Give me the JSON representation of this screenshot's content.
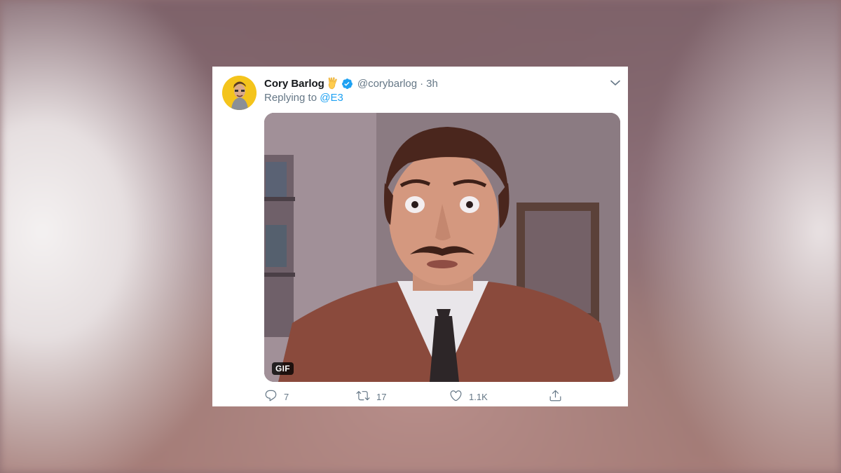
{
  "tweet": {
    "author_name": "Cory Barlog",
    "author_emoji": "vulcan-salute-emoji",
    "verified": true,
    "handle": "@corybarlog",
    "separator": "·",
    "time": "3h",
    "reply_prefix": "Replying to",
    "reply_to": "@E3",
    "media_badge": "GIF",
    "stats": {
      "replies": "7",
      "retweets": "17",
      "likes": "1.1K"
    }
  },
  "icons": {
    "verified": "verified-badge-icon",
    "menu": "chevron-down-icon",
    "reply": "reply-icon",
    "retweet": "retweet-icon",
    "like": "heart-icon",
    "share": "share-icon"
  },
  "colors": {
    "accent": "#1da1f2",
    "secondary_text": "#657786",
    "primary_text": "#14171a",
    "avatar_bg": "#f4c41c"
  }
}
